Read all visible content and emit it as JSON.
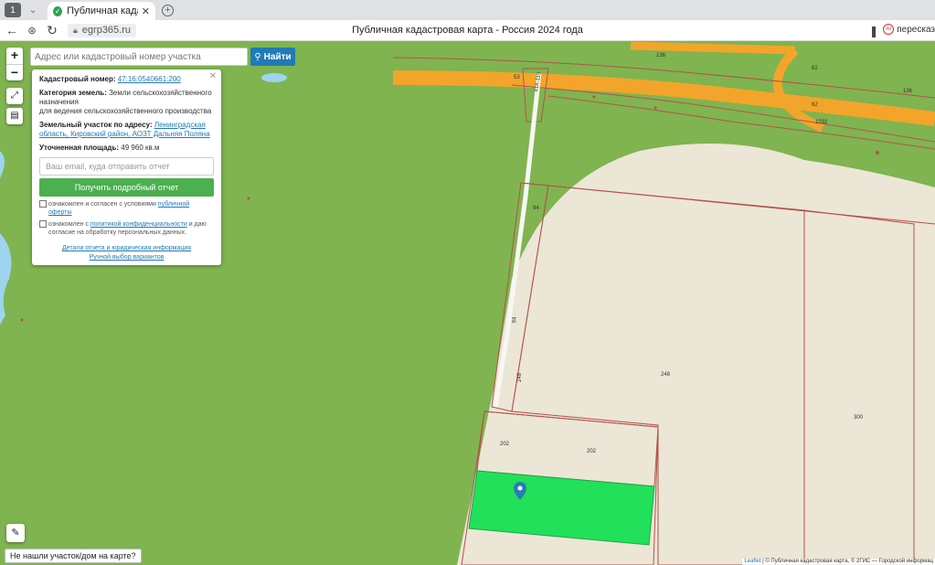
{
  "browser": {
    "tab_count": "1",
    "tab_title": "Публичная кадастров",
    "tab_close": "✕",
    "url": "egrp365.ru",
    "page_title": "Публичная кадастровая карта - Россия 2024 года",
    "extension_label": "пересказ"
  },
  "search": {
    "placeholder": "Адрес или кадастровый номер участка",
    "button_label": "Найти"
  },
  "popup": {
    "cadastral_label": "Кадастровый номер:",
    "cadastral_value": "47:16:0540661:200",
    "category_label": "Категория земель:",
    "category_value": "Земли сельскохозяйственного назначения",
    "category_extra": "для ведения сельскохозяйственного производства",
    "address_label": "Земельный участок по адресу:",
    "address_value": "Ленинградская область, Кировский район, АОЗТ Дальняя Поляна",
    "area_label": "Уточненная площадь:",
    "area_value": "49 960 кв.м",
    "email_placeholder": "Ваш email, куда отправить отчет",
    "report_button": "Получить подробный отчет",
    "consent1_text": "ознакомлен и согласен с условиями",
    "consent1_link": "публичной оферты",
    "consent2_text": "ознакомлен с",
    "consent2_link": "политикой конфиденциальности",
    "consent2_tail": "и даю согласие на обработку персональных данных.",
    "details_link": "Детали отчета и юридическая информация",
    "manual_link": "Ручной выбор вариантов"
  },
  "map_labels": {
    "road_136_a": "136",
    "road_136_b": "136",
    "road_53": "53",
    "road_62a": "62",
    "road_62b": "62",
    "road_1032": "1032",
    "road_41": "41К-119",
    "p94a": "94",
    "p94b": "94",
    "p248a": "248",
    "p248b": "248",
    "p300": "300",
    "p202a": "202",
    "p202b": "202"
  },
  "bottom": {
    "not_found": "Не нашли участок/дом на карте?",
    "attribution_leaflet": "Leaflet",
    "attribution_rest": "| © Публичная кадастровая карта, © 2ГИС — Городской информац"
  },
  "colors": {
    "forest": "#7fb450",
    "field": "#ece6d6",
    "highlight": "#22e05a",
    "road": "#f2a52a",
    "parcel_border": "#b5524a",
    "accent": "#1f7ab8"
  }
}
